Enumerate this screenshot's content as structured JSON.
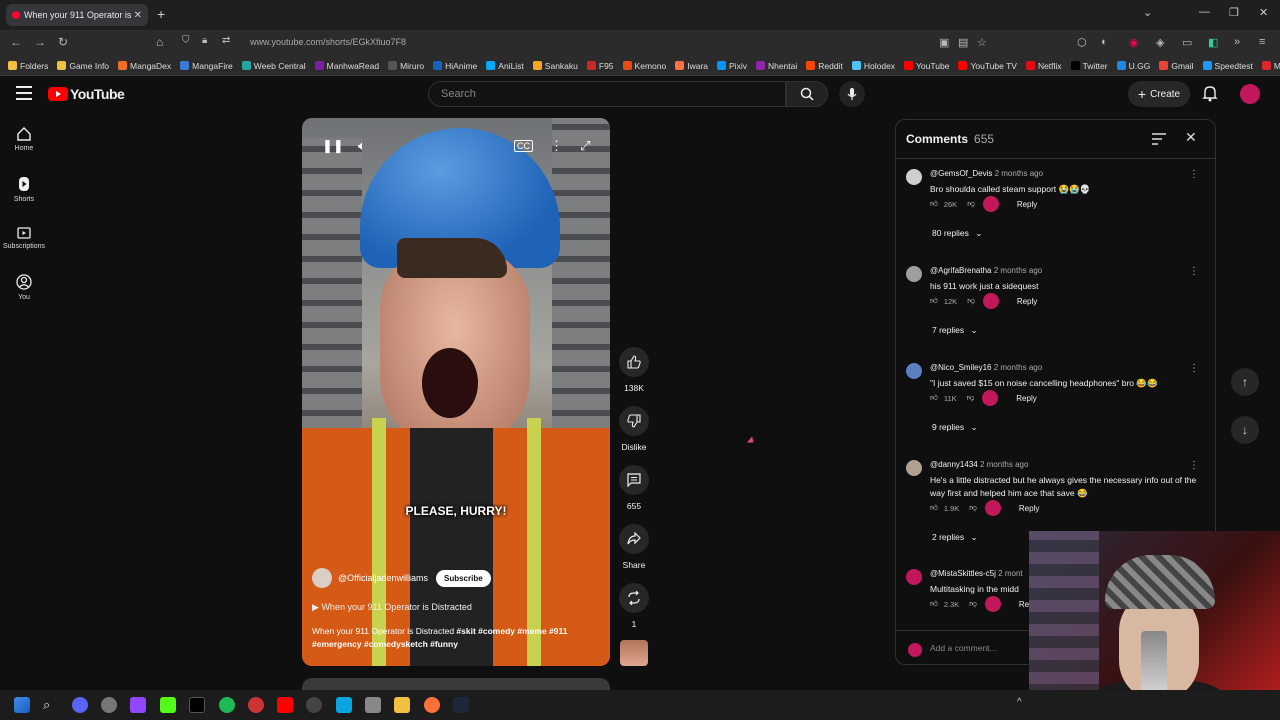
{
  "browser": {
    "tab_title": "When your 911 Operator is",
    "url": "www.youtube.com/shorts/EGkXfiuo7F8",
    "bookmarks": [
      "Folders",
      "Game Info",
      "MangaDex",
      "MangaFire",
      "Weeb Central",
      "ManhwaRead",
      "Miruro",
      "HiAnime",
      "AniList",
      "Sankaku",
      "F95",
      "Kemono",
      "Iwara",
      "Pixiv",
      "Nhentai",
      "Reddit",
      "Holodex",
      "YouTube",
      "YouTube TV",
      "Netflix",
      "Twitter",
      "U.GG",
      "Gmail",
      "Speedtest",
      "MEGA"
    ]
  },
  "header": {
    "logo": "YouTube",
    "search_placeholder": "Search",
    "create_label": "Create"
  },
  "sidebar": {
    "items": [
      {
        "label": "Home",
        "icon": "home-icon"
      },
      {
        "label": "Shorts",
        "icon": "shorts-icon"
      },
      {
        "label": "Subscriptions",
        "icon": "subscriptions-icon"
      },
      {
        "label": "You",
        "icon": "you-icon"
      }
    ]
  },
  "video": {
    "caption": "PLEASE, HURRY!",
    "channel": "@Officialjadenwilliams",
    "subscribe_label": "Subscribe",
    "playlist_title": "When your 911 Operator is Distracted",
    "description_text": "When your 911 Operator is Distracted",
    "hashtags": "#skit #comedy #meme #911 #emergency #comedysketch #funny"
  },
  "actions": {
    "likes": "138K",
    "dislike_label": "Dislike",
    "comments": "655",
    "share_label": "Share",
    "remix": "1"
  },
  "comments": {
    "title": "Comments",
    "count": "655",
    "items": [
      {
        "user": "@GemsOf_Devis",
        "time": "2 months ago",
        "text": "Bro shoulda called steam support 😭😭💀",
        "likes": "26K",
        "replies": "80 replies"
      },
      {
        "user": "@AgrifaBrenatha",
        "time": "2 months ago",
        "text": "his 911 work just a sidequest",
        "likes": "12K",
        "replies": "7 replies"
      },
      {
        "user": "@Nico_Smiley16",
        "time": "2 months ago",
        "text": "\"I just saved $15 on noise cancelling headphones\" bro 😂😂",
        "likes": "11K",
        "replies": "9 replies"
      },
      {
        "user": "@danny1434",
        "time": "2 months ago",
        "text": "He's a little distracted but he always gives the necessary info out of the way first and helped him ace that save 😂",
        "likes": "1.9K",
        "replies": "2 replies"
      },
      {
        "user": "@MistaSkittles-c5j",
        "time": "2 mont",
        "text": "Multitasking in the midd",
        "likes": "2.3K",
        "replies": ""
      }
    ],
    "reply_label": "Reply",
    "add_placeholder": "Add a comment..."
  },
  "colors": {
    "background": "#0f0f0f",
    "brand_red": "#ff0000",
    "accent_pink": "#c2185b"
  }
}
